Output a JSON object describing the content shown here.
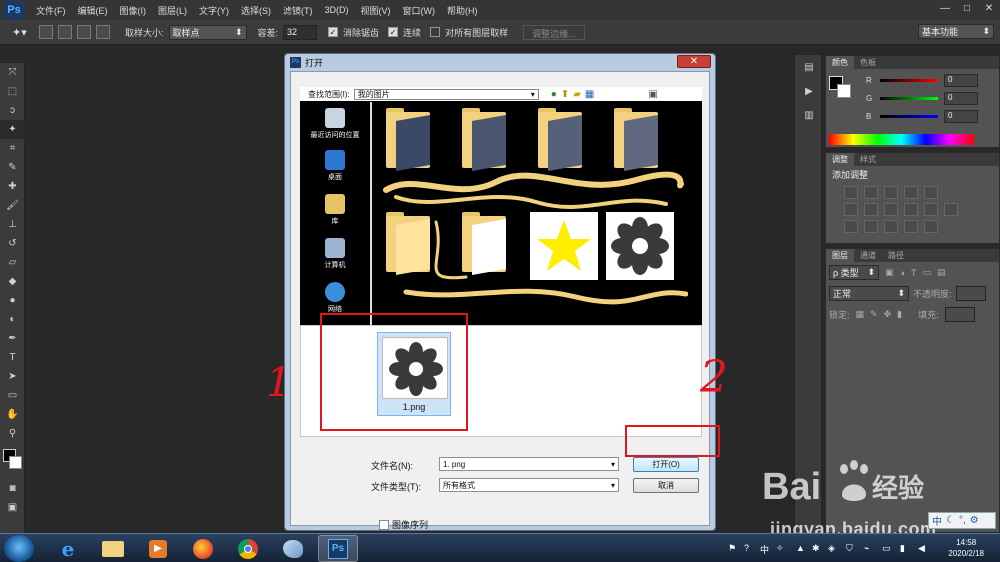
{
  "app": {
    "logo": "Ps",
    "menu": [
      "文件(F)",
      "编辑(E)",
      "图像(I)",
      "图层(L)",
      "文字(Y)",
      "选择(S)",
      "滤镜(T)",
      "3D(D)",
      "视图(V)",
      "窗口(W)",
      "帮助(H)"
    ],
    "window_controls": [
      "—",
      "□",
      "✕"
    ]
  },
  "options": {
    "sample_size_label": "取样大小:",
    "sample_size_value": "取样点",
    "tolerance_label": "容差:",
    "tolerance_value": "32",
    "antialias_label": "消除锯齿",
    "contiguous_label": "连续",
    "all_layers_label": "对所有图层取样",
    "refine_edge_label": "调整边缘...",
    "workspace_value": "基本功能"
  },
  "color_panel": {
    "tabs": [
      "颜色",
      "色板"
    ],
    "r_label": "R",
    "g_label": "G",
    "b_label": "B",
    "r_value": "0",
    "g_value": "0",
    "b_value": "0"
  },
  "adjust_panel": {
    "tabs": [
      "调整",
      "样式"
    ],
    "add_label": "添加调整"
  },
  "layers_panel": {
    "tabs": [
      "图层",
      "通道",
      "路径"
    ],
    "filter_label": "ρ 类型",
    "blend_mode": "正常",
    "opacity_label": "不透明度:",
    "lock_label": "锁定:",
    "fill_label": "填充:"
  },
  "dialog": {
    "title": "打开",
    "look_in_label": "查找范围(I):",
    "look_in_value": "我的图片",
    "places": [
      "最近访问的位置",
      "桌面",
      "库",
      "计算机",
      "网络"
    ],
    "selected_file": "1.png",
    "filename_label": "文件名(N):",
    "filename_value": "1. png",
    "filetype_label": "文件类型(T):",
    "filetype_value": "所有格式",
    "open_button": "打开(O)",
    "cancel_button": "取消",
    "sequence_label": "图像序列"
  },
  "annotations": {
    "mark_1": "1",
    "mark_2": "2"
  },
  "taskbar": {
    "time": "14:58",
    "date": "2020/2/18"
  },
  "watermark": {
    "brand": "Bai 经验",
    "url": "jingyan.baidu.com",
    "ime": "中"
  },
  "colors": {
    "accent_red": "#e0171d",
    "ps_blue": "#53b5ff",
    "folder": "#f2d27e",
    "star": "#ffee00"
  }
}
